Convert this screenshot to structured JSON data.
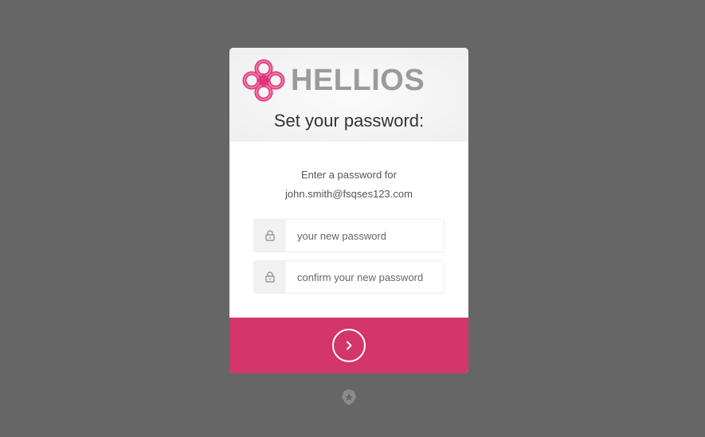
{
  "brand": {
    "name": "HELLIOS",
    "accent_color": "#d4356b",
    "logo_icon": "celtic-knot-logo-icon"
  },
  "header": {
    "title": "Set your password:"
  },
  "instructions": {
    "line1": "Enter a password for",
    "email": "john.smith@fsqses123.com"
  },
  "form": {
    "new_password": {
      "icon": "lock-icon",
      "placeholder": "your new password",
      "value": ""
    },
    "confirm_password": {
      "icon": "lock-icon",
      "placeholder": "confirm your new password",
      "value": ""
    },
    "submit": {
      "icon": "chevron-right-icon"
    }
  },
  "footer": {
    "badge_icon": "auth0-badge-icon"
  }
}
